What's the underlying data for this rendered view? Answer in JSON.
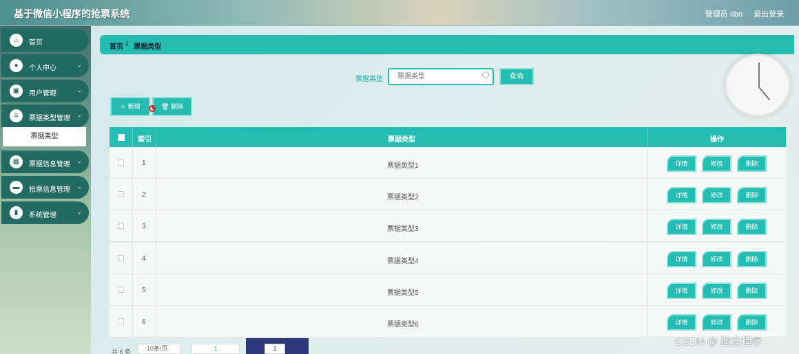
{
  "header": {
    "title": "基于微信小程序的抢票系统",
    "admin": "管理员 abo",
    "logout": "退出登录"
  },
  "sidebar": {
    "items": [
      {
        "label": "首页",
        "icon": "home-icon",
        "glyph": "⌂"
      },
      {
        "label": "个人中心",
        "icon": "user-icon",
        "glyph": "●"
      },
      {
        "label": "用户管理",
        "icon": "clipboard-icon",
        "glyph": "▣"
      },
      {
        "label": "票据类型管理",
        "icon": "list-icon",
        "glyph": "≡"
      },
      {
        "label": "票据信息管理",
        "icon": "grid-icon",
        "glyph": "▦"
      },
      {
        "label": "抢票信息管理",
        "icon": "chat-icon",
        "glyph": "▬"
      },
      {
        "label": "系统管理",
        "icon": "bar-chart-icon",
        "glyph": "▮"
      }
    ],
    "submenu": "票据类型",
    "chevron": "⌄"
  },
  "breadcrumb": {
    "home": "首页",
    "sep": "/",
    "current": "票据类型"
  },
  "search": {
    "label": "票据类型",
    "placeholder": "票据类型",
    "button": "查询"
  },
  "toolbar": {
    "add": "＋ 新增",
    "delete": "🗑 删除"
  },
  "table": {
    "headers": {
      "index": "索引",
      "type": "票据类型",
      "ops": "操作"
    },
    "rows": [
      {
        "index": "1",
        "type": "票据类型1"
      },
      {
        "index": "2",
        "type": "票据类型2"
      },
      {
        "index": "3",
        "type": "票据类型3"
      },
      {
        "index": "4",
        "type": "票据类型4"
      },
      {
        "index": "5",
        "type": "票据类型5"
      },
      {
        "index": "6",
        "type": "票据类型6"
      }
    ],
    "actions": {
      "detail": "详情",
      "edit": "修改",
      "delete": "删除"
    }
  },
  "pager": {
    "total": "共 6 条",
    "size": "10条/页",
    "page": "1",
    "jump": "1"
  },
  "watermark": "CSDN @ 蓝念程序"
}
